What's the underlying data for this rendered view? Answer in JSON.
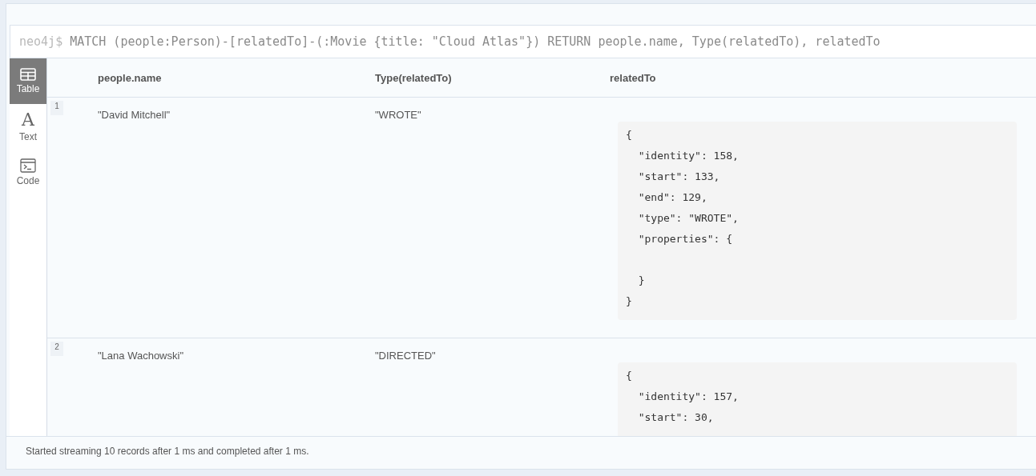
{
  "editor": {
    "prompt": "neo4j$",
    "query": "MATCH (people:Person)-[relatedTo]-(:Movie {title: \"Cloud Atlas\"}) RETURN people.name, Type(relatedTo), relatedTo"
  },
  "sidebar": {
    "items": [
      {
        "kind": "table",
        "label": "Table",
        "selected": true
      },
      {
        "kind": "text",
        "glyph": "A",
        "label": "Text",
        "selected": false
      },
      {
        "kind": "code",
        "label": "Code",
        "selected": false
      }
    ]
  },
  "table": {
    "columns": [
      "people.name",
      "Type(relatedTo)",
      "relatedTo"
    ],
    "rows": [
      {
        "index": "1",
        "name": "\"David Mitchell\"",
        "type": "\"WROTE\"",
        "related_to": [
          {
            "text": "{"
          },
          {
            "text": "  \"identity\": 158,"
          },
          {
            "text": "  \"start\": 133,"
          },
          {
            "text": "  \"end\": 129,"
          },
          {
            "text": "  \"type\": \"WROTE\","
          },
          {
            "text": "  \"properties\": {"
          },
          {
            "text": "  }",
            "gap_before": true
          },
          {
            "text": "}"
          }
        ]
      },
      {
        "index": "2",
        "name": "\"Lana Wachowski\"",
        "type": "\"DIRECTED\"",
        "related_to": [
          {
            "text": "{"
          },
          {
            "text": "  \"identity\": 157,"
          },
          {
            "text": "  \"start\": 30,"
          }
        ]
      }
    ]
  },
  "status_bar": "Started streaming 10 records after 1 ms and completed after 1 ms."
}
